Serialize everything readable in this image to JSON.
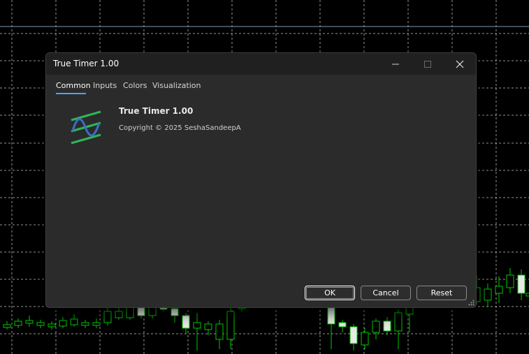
{
  "dialog": {
    "title": "True Timer 1.00",
    "tabs": [
      {
        "label": "Common",
        "active": true
      },
      {
        "label": "Inputs",
        "active": false
      },
      {
        "label": "Colors",
        "active": false
      },
      {
        "label": "Visualization",
        "active": false
      }
    ],
    "product_name": "True Timer 1.00",
    "copyright": "Copyright © 2025 SeshaSandeepA",
    "buttons": {
      "ok": "OK",
      "cancel": "Cancel",
      "reset": "Reset"
    },
    "window_controls": [
      "minimize-icon",
      "maximize-icon",
      "close-icon"
    ]
  },
  "theme": {
    "accent": "#4aa3ff",
    "chart_background": "#000000",
    "grid": "#c8c8c8",
    "candle_outline": "#00c800",
    "logo_green": "#2fb35a",
    "logo_blue": "#3a6fc8"
  }
}
